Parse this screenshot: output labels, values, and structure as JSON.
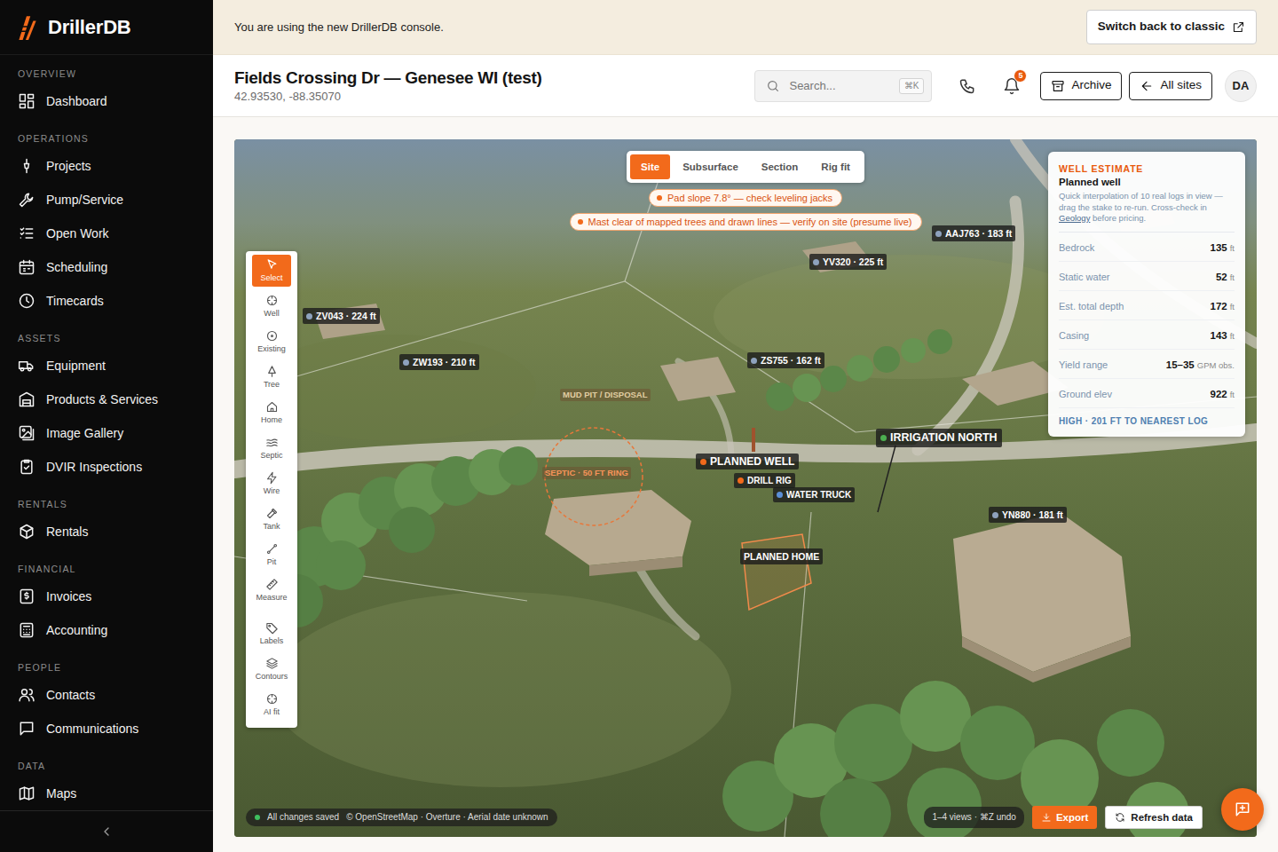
{
  "brand": {
    "name": "DrillerDB"
  },
  "sidebar": {
    "sections": [
      {
        "heading": "OVERVIEW",
        "items": [
          {
            "label": "Dashboard",
            "selected": false
          }
        ]
      },
      {
        "heading": "OPERATIONS",
        "items": [
          {
            "label": "Projects",
            "selected": false
          },
          {
            "label": "Pump/Service",
            "selected": false
          },
          {
            "label": "Open Work",
            "selected": false
          },
          {
            "label": "Scheduling",
            "selected": false
          },
          {
            "label": "Timecards",
            "selected": false
          }
        ]
      },
      {
        "heading": "ASSETS",
        "items": [
          {
            "label": "Equipment",
            "selected": false
          },
          {
            "label": "Products & Services",
            "selected": false
          },
          {
            "label": "Image Gallery",
            "selected": false
          },
          {
            "label": "DVIR Inspections",
            "selected": false
          }
        ]
      },
      {
        "heading": "RENTALS",
        "items": [
          {
            "label": "Rentals",
            "selected": false
          }
        ]
      },
      {
        "heading": "FINANCIAL",
        "items": [
          {
            "label": "Invoices",
            "selected": false
          },
          {
            "label": "Accounting",
            "selected": false
          }
        ]
      },
      {
        "heading": "PEOPLE",
        "items": [
          {
            "label": "Contacts",
            "selected": false
          },
          {
            "label": "Communications",
            "selected": false
          }
        ]
      },
      {
        "heading": "DATA",
        "items": [
          {
            "label": "Maps",
            "selected": false
          }
        ]
      }
    ]
  },
  "banner": {
    "text": "You are using the new DrillerDB console.",
    "button": "Switch back to classic"
  },
  "header": {
    "title": "Fields Crossing Dr — Genesee WI (test)",
    "coords": "42.93530, -88.35070",
    "search": {
      "placeholder": "Search...",
      "shortcut": "⌘K"
    },
    "notifications": "5",
    "archive": "Archive",
    "all_sites": "All sites",
    "avatar": "DA"
  },
  "map": {
    "tabs": [
      {
        "label": "Site",
        "selected": true
      },
      {
        "label": "Subsurface",
        "selected": false
      },
      {
        "label": "Section",
        "selected": false
      },
      {
        "label": "Rig fit",
        "selected": false
      }
    ],
    "alerts": [
      "Pad slope 7.8° — check leveling jacks",
      "Mast clear of mapped trees and drawn lines — verify on site (presume live)"
    ],
    "tools": [
      {
        "label": "Select",
        "selected": true
      },
      {
        "label": "Well",
        "selected": false
      },
      {
        "label": "Existing",
        "selected": false
      },
      {
        "label": "Tree",
        "selected": false
      },
      {
        "label": "Home",
        "selected": false
      },
      {
        "label": "Septic",
        "selected": false
      },
      {
        "label": "Wire",
        "selected": false
      },
      {
        "label": "Tank",
        "selected": false
      },
      {
        "label": "Pit",
        "selected": false
      },
      {
        "label": "Measure",
        "selected": false
      },
      {
        "label": "Labels",
        "selected": false
      },
      {
        "label": "Contours",
        "selected": false
      },
      {
        "label": "AI fit",
        "selected": false
      }
    ],
    "pins": [
      {
        "label": "ZV043 · 224 ft",
        "kind": "log",
        "color": "#8ea2bd"
      },
      {
        "label": "ZW193 · 210 ft",
        "kind": "log",
        "color": "#8ea2bd"
      },
      {
        "label": "AAJ763 · 183 ft",
        "kind": "log",
        "color": "#8ea2bd"
      },
      {
        "label": "YV320 · 225 ft",
        "kind": "log",
        "color": "#8ea2bd"
      },
      {
        "label": "ZS755 · 162 ft",
        "kind": "log",
        "color": "#8ea2bd"
      },
      {
        "label": "IRRIGATION NORTH",
        "kind": "irrigation",
        "color": "#4caf50"
      },
      {
        "label": "YN880 · 181 ft",
        "kind": "log",
        "color": "#8ea2bd"
      },
      {
        "label": "PLANNED WELL",
        "kind": "planned",
        "color": "#f26a1b"
      },
      {
        "label": "DRILL RIG",
        "kind": "equipment",
        "color": "#f26a1b"
      },
      {
        "label": "WATER TRUCK",
        "kind": "equipment",
        "color": "#5b8fd6"
      },
      {
        "label": "PLANNED HOME",
        "kind": "outline"
      },
      {
        "label": "MUD PIT / DISPOSAL",
        "kind": "zone",
        "color": "#e0cda2"
      },
      {
        "label": "SEPTIC · 50 FT RING",
        "kind": "zone",
        "color": "#f6935a"
      }
    ],
    "estimate": {
      "heading": "WELL ESTIMATE",
      "title": "Planned well",
      "note_before": "Quick interpolation of 10 real logs in view — drag the stake to re-run. Cross-check in ",
      "note_link": "Geology",
      "note_after": " before pricing.",
      "rows": [
        {
          "label": "Bedrock",
          "value": "135",
          "unit": "ft"
        },
        {
          "label": "Static water",
          "value": "52",
          "unit": "ft"
        },
        {
          "label": "Est. total depth",
          "value": "172",
          "unit": "ft"
        },
        {
          "label": "Casing",
          "value": "143",
          "unit": "ft"
        },
        {
          "label": "Yield range",
          "value": "15–35",
          "unit": "GPM obs."
        },
        {
          "label": "Ground elev",
          "value": "922",
          "unit": "ft"
        }
      ],
      "confidence": "HIGH · 201 FT TO NEAREST LOG"
    },
    "status": {
      "saved": "All changes saved",
      "attribution": "© OpenStreetMap · Overture · Aerial date unknown"
    },
    "hint": "1–4 views · ⌘Z undo",
    "export": "Export",
    "refresh": "Refresh data"
  }
}
